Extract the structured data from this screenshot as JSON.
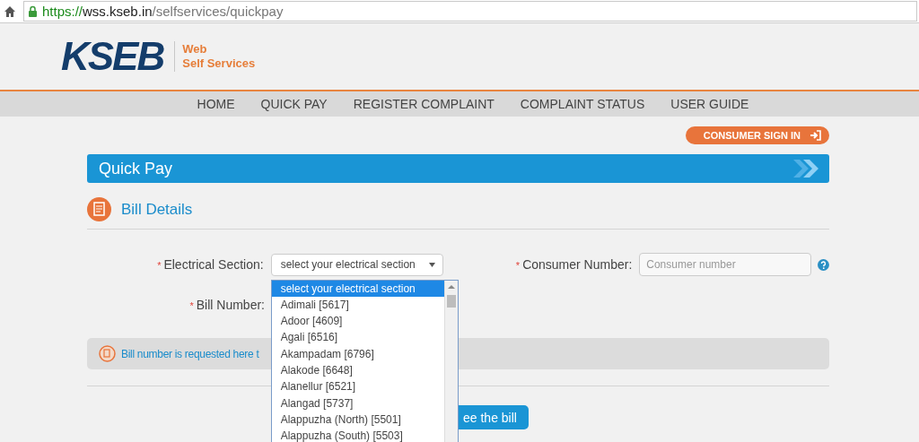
{
  "browser": {
    "url": {
      "scheme": "https://",
      "host": "wss.kseb.in",
      "path": "/selfservices/quickpay"
    }
  },
  "header": {
    "logo": "KSEB",
    "tagline": [
      "Web",
      "Self Services"
    ]
  },
  "nav": [
    {
      "label": "HOME"
    },
    {
      "label": "QUICK PAY"
    },
    {
      "label": "REGISTER COMPLAINT"
    },
    {
      "label": "COMPLAINT STATUS"
    },
    {
      "label": "USER GUIDE"
    }
  ],
  "sign_in": "CONSUMER SIGN IN",
  "page_title": "Quick Pay",
  "section_title": "Bill Details",
  "form": {
    "electrical_section": {
      "label": "Electrical Section:",
      "value": "select your electrical section"
    },
    "consumer_number": {
      "label": "Consumer Number:",
      "placeholder": "Consumer number"
    },
    "bill_number": {
      "label": "Bill Number:"
    },
    "required_mark": "*"
  },
  "info": "Bill number is requested here t",
  "submit": "ee the bill",
  "dropdown": [
    {
      "label": "select your electrical section",
      "selected": true
    },
    {
      "label": "Adimali [5617]",
      "selected": false
    },
    {
      "label": "Adoor [4609]",
      "selected": false
    },
    {
      "label": "Agali [6516]",
      "selected": false
    },
    {
      "label": "Akampadam [6796]",
      "selected": false
    },
    {
      "label": "Alakode [6648]",
      "selected": false
    },
    {
      "label": "Alanellur [6521]",
      "selected": false
    },
    {
      "label": "Alangad [5737]",
      "selected": false
    },
    {
      "label": "Alappuzha (North) [5501]",
      "selected": false
    },
    {
      "label": "Alappuzha (South) [5503]",
      "selected": false
    }
  ]
}
